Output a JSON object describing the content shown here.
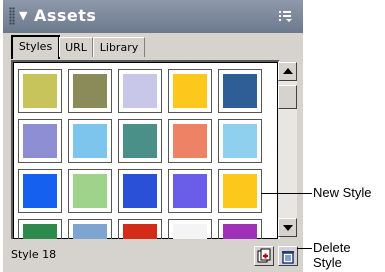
{
  "panel": {
    "title": "Assets",
    "title_arrow": "▼",
    "menu_icon": "options-menu-icon"
  },
  "tabs": [
    {
      "label": "Styles",
      "active": true
    },
    {
      "label": "URL",
      "active": false
    },
    {
      "label": "Library",
      "active": false
    }
  ],
  "swatches": [
    {
      "name": "swatch-1",
      "color": "#c8c45c"
    },
    {
      "name": "swatch-2",
      "color": "#8a8b58"
    },
    {
      "name": "swatch-3",
      "color": "#c9c7e8"
    },
    {
      "name": "swatch-4",
      "color": "#fcc81b"
    },
    {
      "name": "swatch-5",
      "color": "#2e5e95"
    },
    {
      "name": "swatch-6",
      "color": "#8e8ed4"
    },
    {
      "name": "swatch-7",
      "color": "#7ec5ee"
    },
    {
      "name": "swatch-8",
      "color": "#4a9088"
    },
    {
      "name": "swatch-9",
      "color": "#ee8264"
    },
    {
      "name": "swatch-10",
      "color": "#8ed0ee"
    },
    {
      "name": "swatch-11",
      "color": "#1660f0"
    },
    {
      "name": "swatch-12",
      "color": "#9fd28a"
    },
    {
      "name": "swatch-13",
      "color": "#2a50d8"
    },
    {
      "name": "swatch-14",
      "color": "#6a5ee8"
    },
    {
      "name": "swatch-15",
      "color": "#fcc81b"
    },
    {
      "name": "swatch-16",
      "color": "#2e8a4a"
    },
    {
      "name": "swatch-17",
      "color": "#7ea4d0"
    },
    {
      "name": "swatch-18",
      "color": "#d42a18"
    },
    {
      "name": "swatch-19",
      "color": "#f4f4f4"
    },
    {
      "name": "swatch-20",
      "color": "#a030b8"
    }
  ],
  "status": {
    "selected_style": "Style 18"
  },
  "buttons": {
    "new_icon": "new-style-icon",
    "delete_icon": "trash-icon"
  },
  "callouts": {
    "new_style": "New Style",
    "delete_style_line1": "Delete",
    "delete_style_line2": "Style"
  }
}
